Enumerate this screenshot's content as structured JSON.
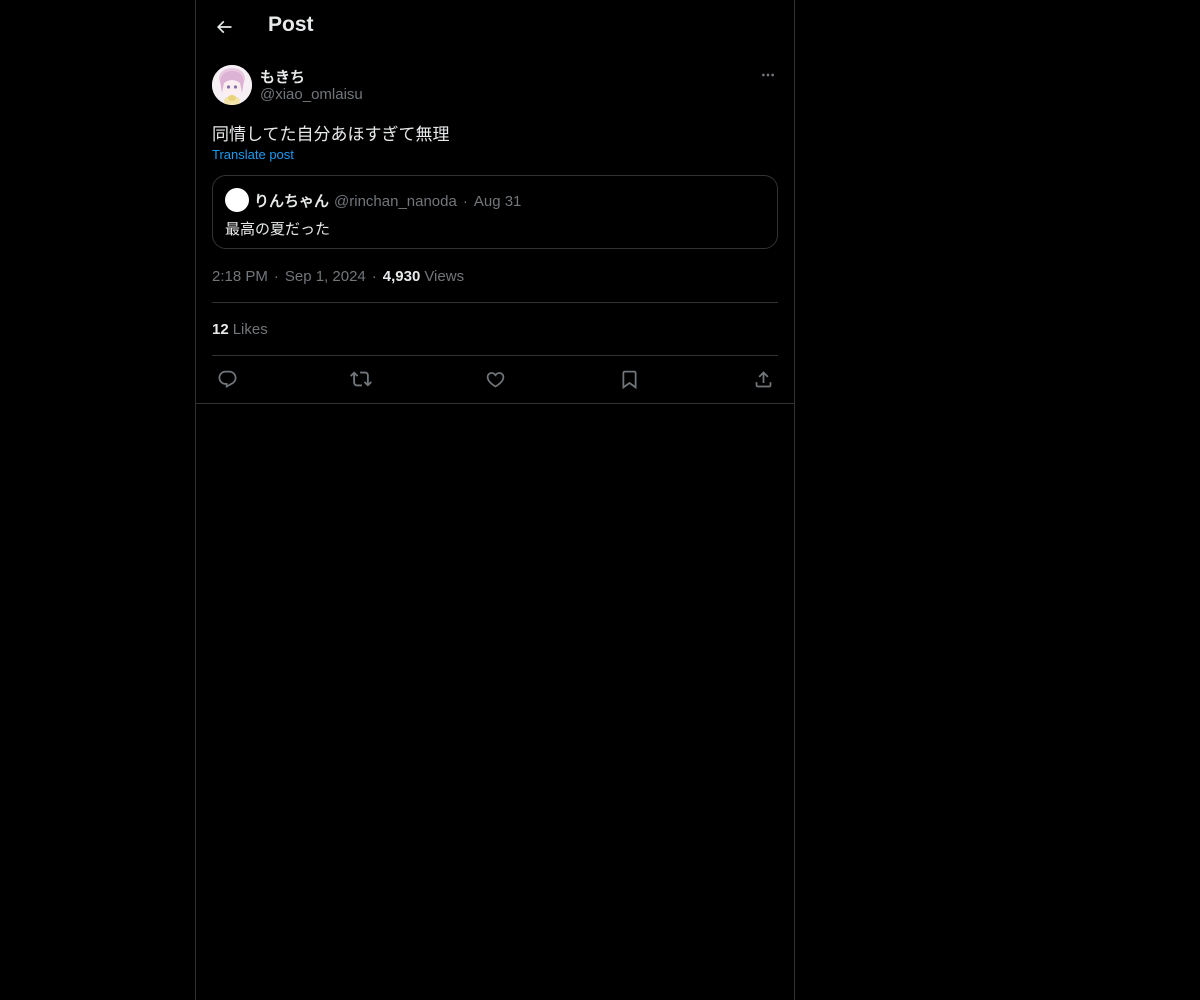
{
  "header": {
    "title": "Post",
    "back_icon": "arrow-left-icon"
  },
  "post": {
    "author": {
      "name": "もきち",
      "handle": "@xiao_omlaisu",
      "avatar": "anime-avatar-image"
    },
    "more_icon": "more-horizontal-icon",
    "text": "同情してた自分あほすぎて無理",
    "translate_label": "Translate post",
    "quote": {
      "name": "りんちゃん",
      "handle": "@rinchan_nanoda",
      "separator": "·",
      "date": "Aug 31",
      "text": "最高の夏だった"
    },
    "time": "2:18 PM",
    "separator": "·",
    "date": "Sep 1, 2024",
    "views_count": "4,930",
    "views_label": "Views",
    "likes_count": "12",
    "likes_label": "Likes"
  },
  "actions": [
    {
      "name": "reply",
      "icon": "reply-icon"
    },
    {
      "name": "repost",
      "icon": "repost-icon"
    },
    {
      "name": "like",
      "icon": "heart-icon"
    },
    {
      "name": "bookmark",
      "icon": "bookmark-icon"
    },
    {
      "name": "share",
      "icon": "share-icon"
    }
  ],
  "colors": {
    "background": "#000000",
    "text": "#e7e9ea",
    "secondary_text": "#71767b",
    "link": "#1d9bf0",
    "border": "#2f3336"
  }
}
